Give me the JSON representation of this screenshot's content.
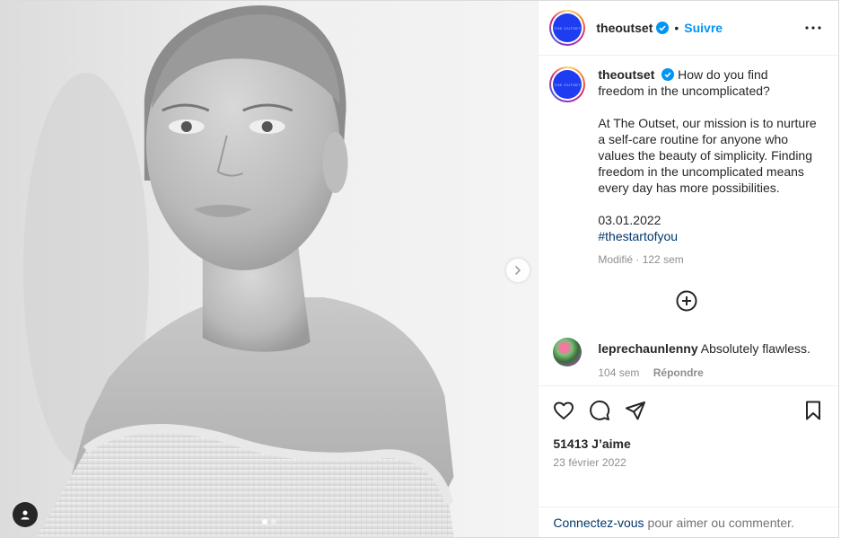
{
  "post": {
    "account": {
      "username": "theoutset",
      "avatar_text": "THE OUTSET",
      "verified": true,
      "separator": "•",
      "follow_label": "Suivre"
    },
    "media": {
      "slides_total": 2,
      "slide_active": 1
    },
    "caption": {
      "username": "theoutset",
      "first_line": "How do you find freedom in the uncomplicated?",
      "body": "At The Outset, our mission is to nurture a self-care routine for anyone who values the beauty of simplicity. Finding freedom in the uncomplicated means every day has more possibilities.",
      "date_line": "03.01.2022",
      "hashtag": "#thestartofyou",
      "meta": "Modifié · 122 sem"
    },
    "comments": [
      {
        "username": "leprechaunlenny",
        "text": "Absolutely flawless.",
        "time": "104 sem",
        "reply_label": "Répondre"
      }
    ],
    "likes": "51413 J’aime",
    "date": "23 février 2022",
    "login_prompt": {
      "link": "Connectez-vous",
      "rest": "pour aimer ou commenter."
    }
  },
  "colors": {
    "accent": "#0095f6",
    "link": "#00376b",
    "muted": "#8e8e8e",
    "text": "#262626"
  },
  "icons": [
    "more-icon",
    "verified-icon",
    "add-comment-icon",
    "heart-icon",
    "comment-icon",
    "share-icon",
    "bookmark-icon",
    "chevron-right-icon",
    "user-tag-icon"
  ]
}
